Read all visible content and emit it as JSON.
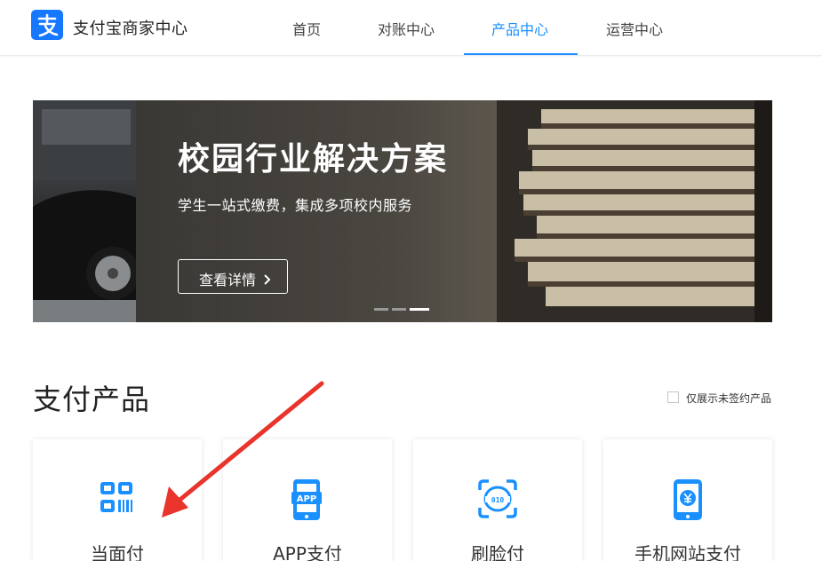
{
  "header": {
    "brand": "支付宝商家中心",
    "nav": [
      "首页",
      "对账中心",
      "产品中心",
      "运营中心"
    ],
    "active_index": 2
  },
  "banner": {
    "title": "校园行业解决方案",
    "subtitle": "学生一站式缴费，集成多项校内服务",
    "button_label": "查看详情",
    "slide_count": 3,
    "active_slide": 3
  },
  "section": {
    "title": "支付产品",
    "filter_label": "仅展示未签约产品"
  },
  "products": [
    {
      "label": "当面付",
      "icon": "qr-scan-icon"
    },
    {
      "label": "APP支付",
      "icon": "app-phone-icon"
    },
    {
      "label": "刷脸付",
      "icon": "face-scan-icon"
    },
    {
      "label": "手机网站支付",
      "icon": "mobile-yuan-icon"
    }
  ],
  "colors": {
    "accent": "#1890ff",
    "brand": "#1677ff",
    "icon_blue": "#1a90ff",
    "annotation_arrow": "#e8342b"
  }
}
